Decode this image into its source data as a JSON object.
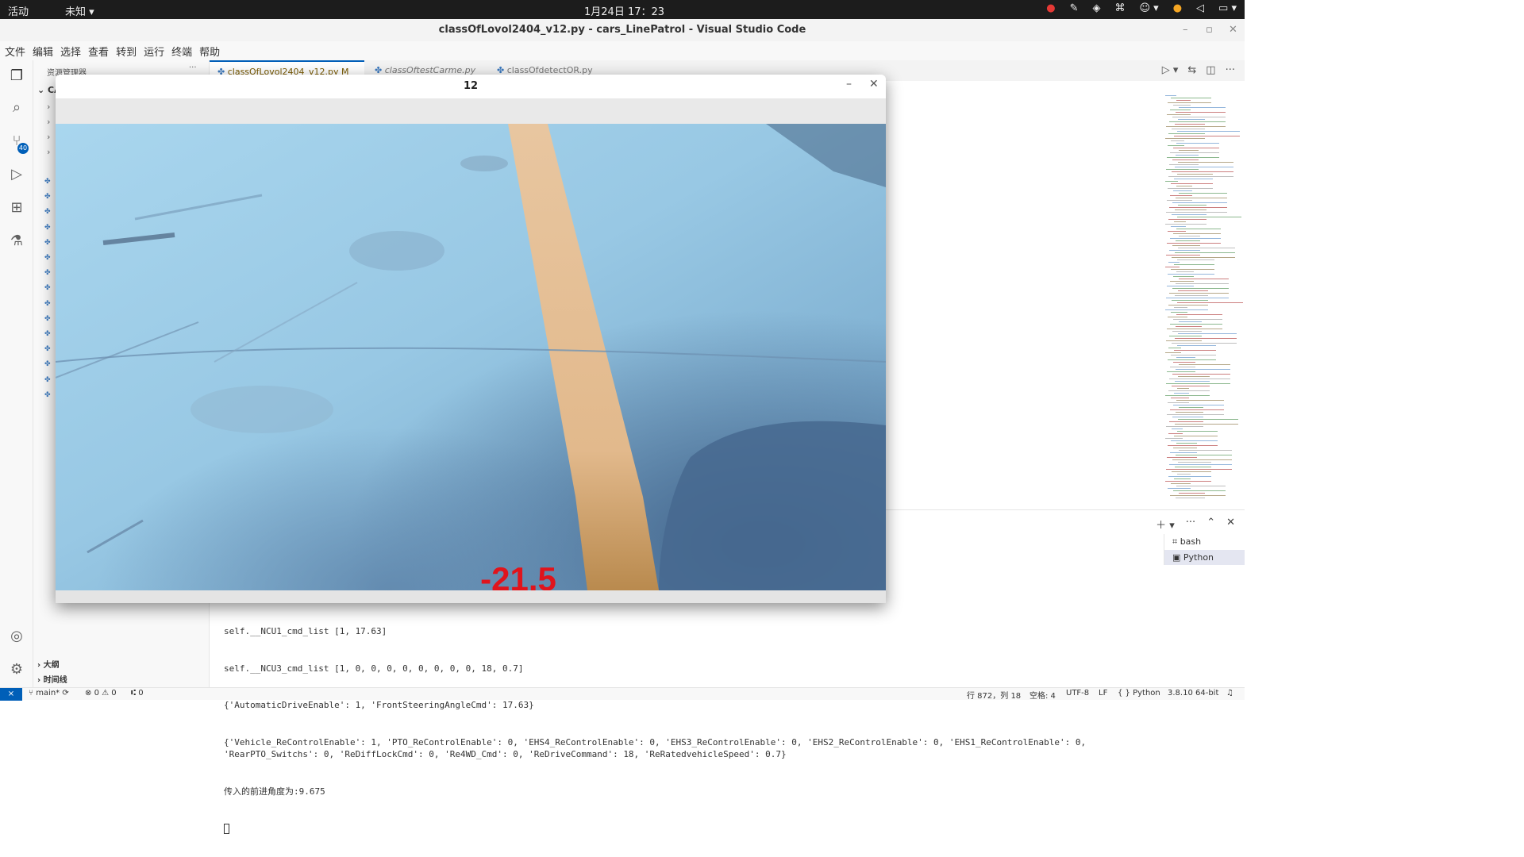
{
  "topbar": {
    "activities": "活动",
    "app_menu": "未知 ▾",
    "clock": "1月24日  17：23"
  },
  "window_title": "classOfLovol2404_v12.py - cars_LinePatrol - Visual Studio Code",
  "menu": [
    "文件",
    "编辑",
    "选择",
    "查看",
    "转到",
    "运行",
    "终端",
    "帮助"
  ],
  "activity_badge": "40",
  "sidebar": {
    "title": "资源管理器",
    "more": "···",
    "root": "CA",
    "outline": "大纲",
    "timeline": "时间线"
  },
  "tabs": [
    {
      "label": "classOfLovol2404_v12.py  M",
      "close": "✕"
    },
    {
      "label": "classOftestCarme.py"
    },
    {
      "label": "classOfdetectOR.py"
    }
  ],
  "terminals": [
    "bash",
    "Python"
  ],
  "terminal_lines": [
    "self.__NCU1_cmd_list [1, 17.63]",
    "self.__NCU3_cmd_list [1, 0, 0, 0, 0, 0, 0, 0, 0, 18, 0.7]",
    "{'AutomaticDriveEnable': 1, 'FrontSteeringAngleCmd': 17.63}",
    "{'Vehicle_ReControlEnable': 1, 'PTO_ReControlEnable': 0, 'EHS4_ReControlEnable': 0, 'EHS3_ReControlEnable': 0, 'EHS2_ReControlEnable': 0, 'EHS1_ReControlEnable': 0, 'RearPTO_Switchs': 0, 'ReDiffLockCmd': 0, 'Re4WD_Cmd': 0, 'ReDriveCommand': 18, 'ReRatedvehicleSpeed': 0.7}",
    "传入的前进角度为:9.675"
  ],
  "status": {
    "branch": "main*",
    "errors": "0",
    "warnings": "0",
    "ports": "0",
    "position": "行 872，列 18",
    "spaces": "空格: 4",
    "encoding": "UTF-8",
    "eol": "LF",
    "language": "Python",
    "interpreter": "3.8.10 64-bit"
  },
  "image_window": {
    "title": "12",
    "overlay_value": "-21.5",
    "overlay_color": "#e0141c"
  },
  "colors": {
    "accent": "#005fb8",
    "topbar": "#1c1c1c",
    "tab_modified": "#7a5a00"
  }
}
